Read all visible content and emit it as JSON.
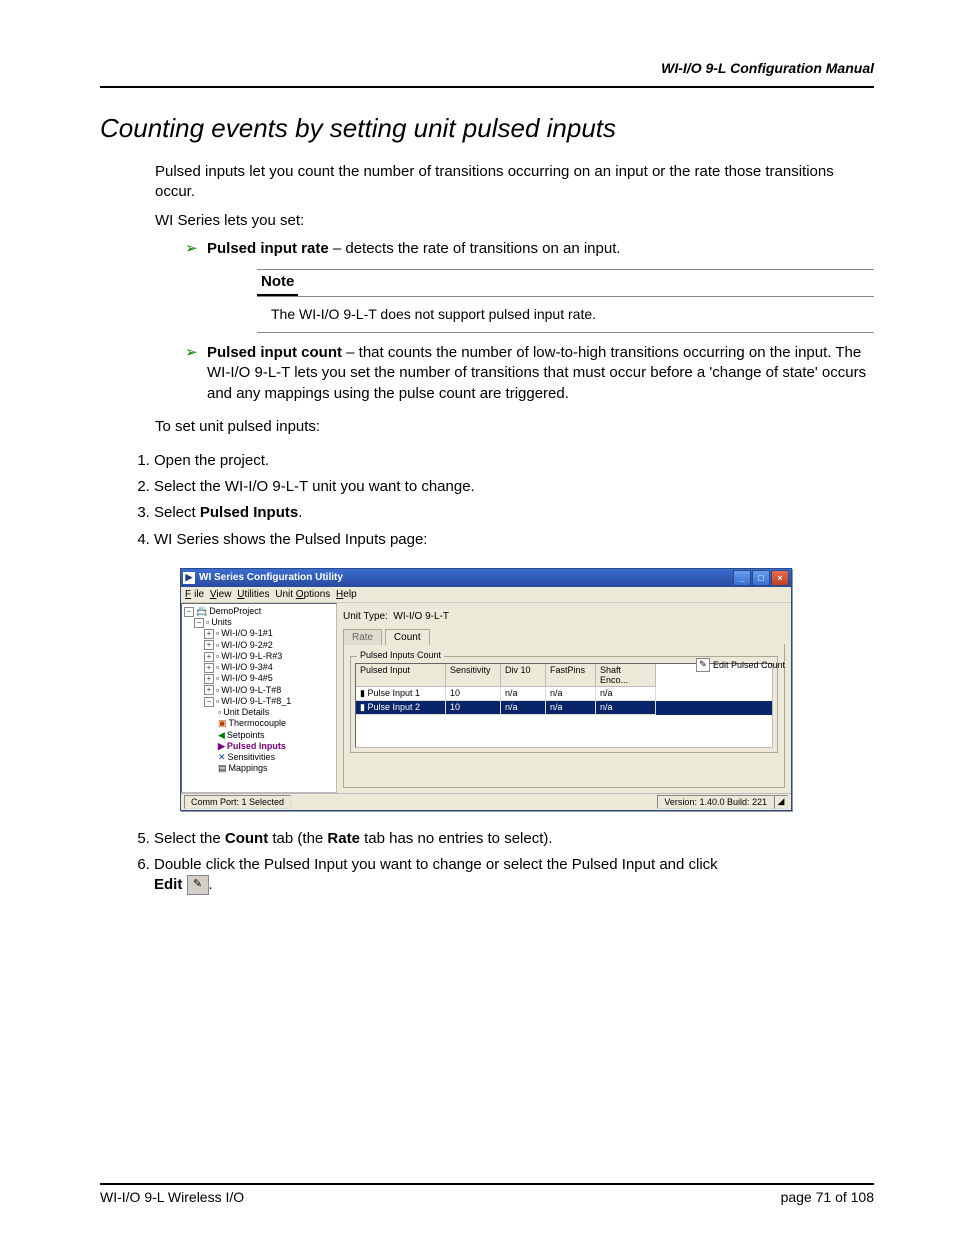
{
  "header": {
    "right": "WI-I/O 9-L Configuration Manual"
  },
  "section_title": "Counting events by setting unit pulsed inputs",
  "intro_p1": "Pulsed inputs let you count the number of transitions occurring on an input or the rate those transitions occur.",
  "intro_p2": "WI Series lets you set:",
  "bullet1": {
    "prefix": "Pulsed input rate",
    "rest": " – detects the rate of transitions on an input."
  },
  "note": {
    "label": "Note",
    "body": "The WI-I/O 9-L-T does not support pulsed input rate."
  },
  "bullet2": {
    "prefix": "Pulsed input count",
    "rest": " – that counts the number of low-to-high transitions occurring on the input. The WI-I/O 9-L-T lets you set the number of transitions that must occur before a 'change of state' occurs and any mappings using the pulse count are triggered."
  },
  "proc_lead": "To set unit pulsed inputs:",
  "steps": {
    "s1": "Open the project.",
    "s2": "Select the WI-I/O 9-L-T unit you want to change.",
    "s3a": "Select ",
    "s3b": "Pulsed Inputs",
    "s3c": ".",
    "s4": "WI Series shows the Pulsed Inputs page:",
    "s5a": "Select the ",
    "s5b": "Count",
    "s5c": " tab (the ",
    "s5d": "Rate",
    "s5e": " tab has no entries to select).",
    "s6a": "Double click the Pulsed Input you want to change or select the Pulsed Input and click ",
    "s6b": "Edit",
    "s6c": "."
  },
  "app": {
    "title": "WI Series Configuration Utility",
    "menu": {
      "file": "File",
      "view": "View",
      "util": "Utilities",
      "unit": "Unit Options",
      "help": "Help"
    },
    "tree": {
      "root": "DemoProject",
      "units": "Units",
      "items": [
        "WI-I/O 9-1#1",
        "WI-I/O 9-2#2",
        "WI-I/O 9-L-R#3",
        "WI-I/O 9-3#4",
        "WI-I/O 9-4#5",
        "WI-I/O 9-L-T#8",
        "WI-I/O 9-L-T#8_1"
      ],
      "sub": {
        "ud": "Unit Details",
        "tc": "Thermocouple",
        "sp": "Setpoints",
        "pi": "Pulsed Inputs",
        "se": "Sensitivities",
        "mp": "Mappings"
      }
    },
    "unit_type_label": "Unit Type:",
    "unit_type_value": "WI-I/O 9-L-T",
    "tab_rate": "Rate",
    "tab_count": "Count",
    "group_title": "Pulsed Inputs Count",
    "edit_btn": "Edit Pulsed Count",
    "cols": {
      "c1": "Pulsed Input",
      "c2": "Sensitivity",
      "c3": "Div 10",
      "c4": "FastPins",
      "c5": "Shaft Enco..."
    },
    "rows": [
      {
        "c1": "Pulse Input 1",
        "c2": "10",
        "c3": "n/a",
        "c4": "n/a",
        "c5": "n/a"
      },
      {
        "c1": "Pulse Input 2",
        "c2": "10",
        "c3": "n/a",
        "c4": "n/a",
        "c5": "n/a"
      }
    ],
    "status_left": "Comm Port: 1 Selected",
    "status_right": "Version: 1.40.0 Build: 221"
  },
  "footer": {
    "left": "WI-I/O 9-L Wireless I/O",
    "right": "page  71 of 108"
  }
}
